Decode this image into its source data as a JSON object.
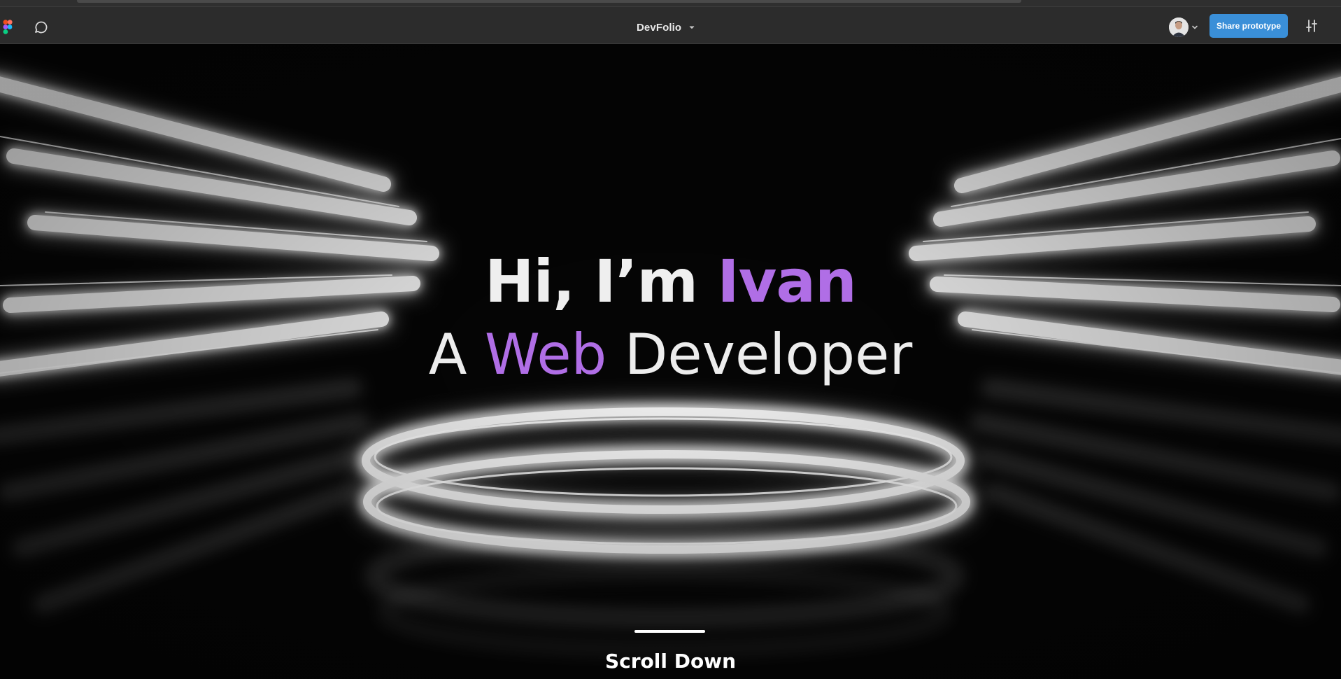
{
  "toolbar": {
    "file_name": "DevFolio",
    "share_label": "Share prototype"
  },
  "hero": {
    "greeting": "Hi, I’m",
    "name": "Ivan",
    "role_prefix": "A",
    "role_accent": "Web",
    "role_suffix": "Developer",
    "scroll_label": "Scroll Down"
  },
  "icons": {
    "app_logo": "figma-logo-icon",
    "comment": "comment-icon",
    "dropdown": "chevron-down-icon",
    "settings": "sliders-icon"
  },
  "colors": {
    "accent": "#b06ee6",
    "share_button": "#3a8fd8",
    "canvas_bg": "#050505",
    "toolbar_bg": "#2c2c2c"
  }
}
